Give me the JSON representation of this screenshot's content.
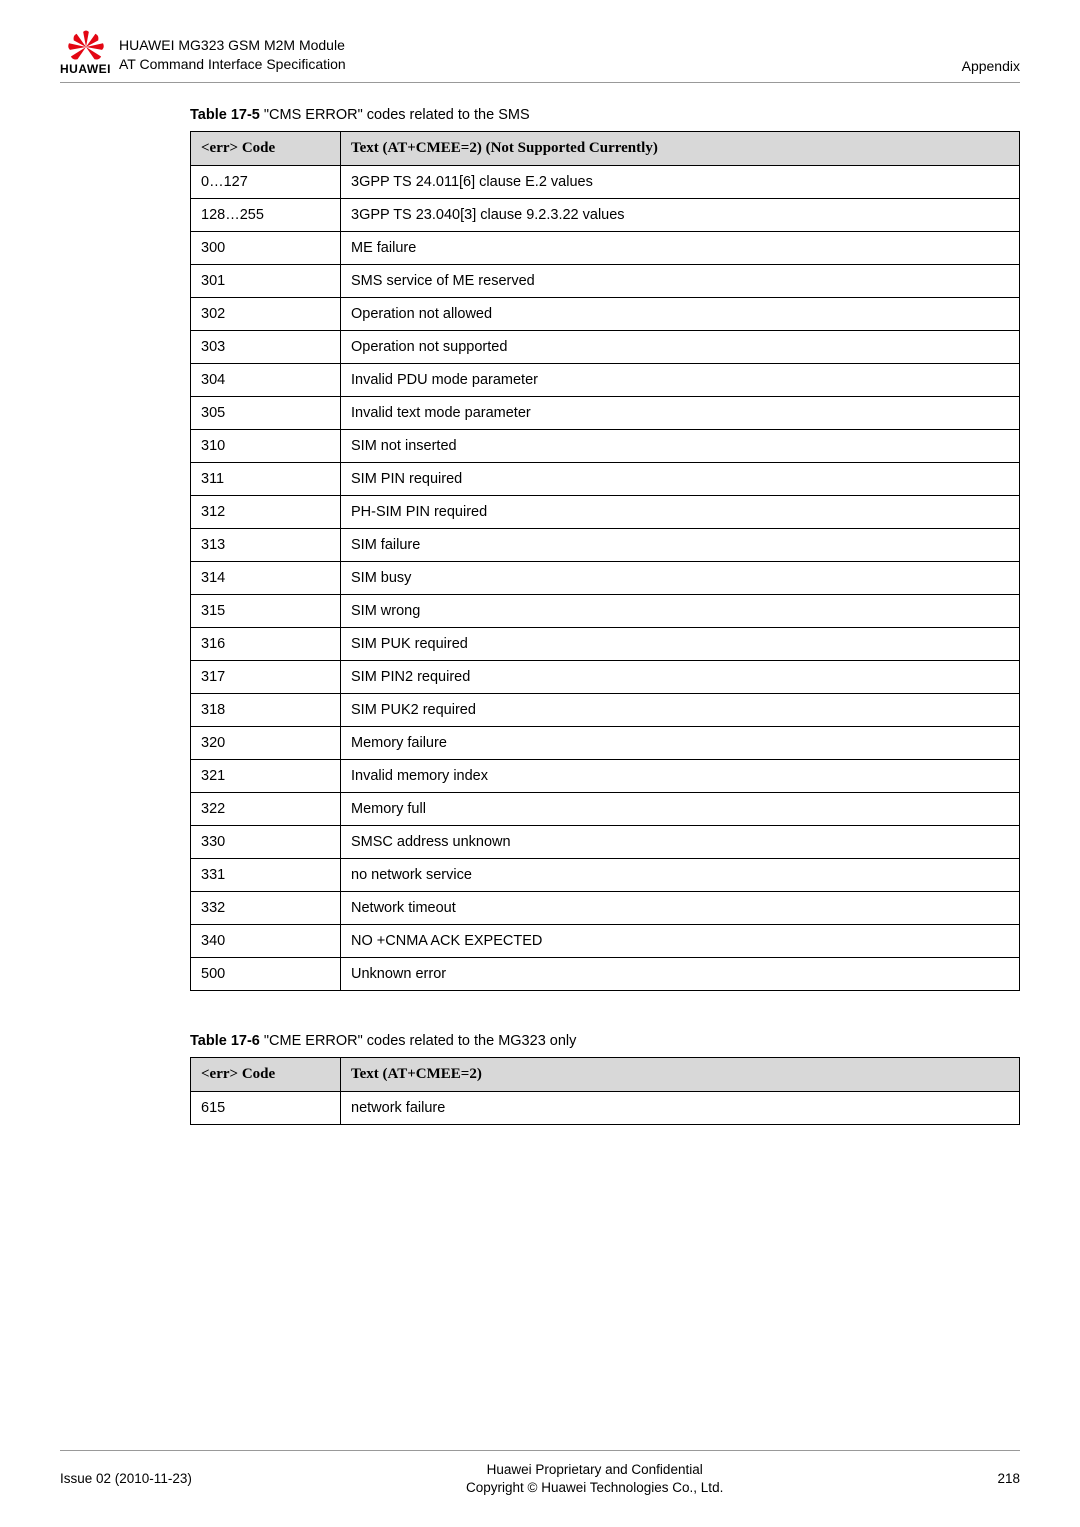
{
  "header": {
    "brand": "HUAWEI",
    "title_line1": "HUAWEI MG323 GSM M2M Module",
    "title_line2": "AT Command Interface Specification",
    "right": "Appendix"
  },
  "table1": {
    "caption_bold": "Table 17-5 ",
    "caption_rest": "\"CMS ERROR\" codes related to the SMS",
    "head_col0": "<err> Code",
    "head_col1": "Text (AT+CMEE=2) (Not Supported Currently)",
    "rows": [
      {
        "c0": "0…127",
        "c1": "3GPP TS 24.011[6] clause E.2 values"
      },
      {
        "c0": "128…255",
        "c1": "3GPP TS 23.040[3] clause 9.2.3.22 values"
      },
      {
        "c0": "300",
        "c1": "ME failure"
      },
      {
        "c0": "301",
        "c1": "SMS service of ME reserved"
      },
      {
        "c0": "302",
        "c1": "Operation not allowed"
      },
      {
        "c0": "303",
        "c1": "Operation not supported"
      },
      {
        "c0": "304",
        "c1": "Invalid PDU mode parameter"
      },
      {
        "c0": "305",
        "c1": "Invalid text mode parameter"
      },
      {
        "c0": "310",
        "c1": "SIM not inserted"
      },
      {
        "c0": "311",
        "c1": "SIM PIN required"
      },
      {
        "c0": "312",
        "c1": "PH-SIM PIN required"
      },
      {
        "c0": "313",
        "c1": "SIM failure"
      },
      {
        "c0": "314",
        "c1": "SIM busy"
      },
      {
        "c0": "315",
        "c1": "SIM wrong"
      },
      {
        "c0": "316",
        "c1": "SIM PUK required"
      },
      {
        "c0": "317",
        "c1": "SIM PIN2 required"
      },
      {
        "c0": "318",
        "c1": "SIM PUK2 required"
      },
      {
        "c0": "320",
        "c1": "Memory failure"
      },
      {
        "c0": "321",
        "c1": "Invalid memory index"
      },
      {
        "c0": "322",
        "c1": "Memory full"
      },
      {
        "c0": "330",
        "c1": "SMSC address unknown"
      },
      {
        "c0": "331",
        "c1": "no network service"
      },
      {
        "c0": "332",
        "c1": "Network timeout"
      },
      {
        "c0": "340",
        "c1": "NO +CNMA ACK EXPECTED"
      },
      {
        "c0": "500",
        "c1": "Unknown error"
      }
    ]
  },
  "table2": {
    "caption_bold": "Table 17-6 ",
    "caption_rest": "\"CME ERROR\" codes related to the MG323 only",
    "head_col0": "<err> Code",
    "head_col1": "Text (AT+CMEE=2)",
    "rows": [
      {
        "c0": "615",
        "c1": "network failure"
      }
    ]
  },
  "footer": {
    "left": "Issue 02 (2010-11-23)",
    "center_line1": "Huawei Proprietary and Confidential",
    "center_line2": "Copyright © Huawei Technologies Co., Ltd.",
    "right": "218"
  }
}
